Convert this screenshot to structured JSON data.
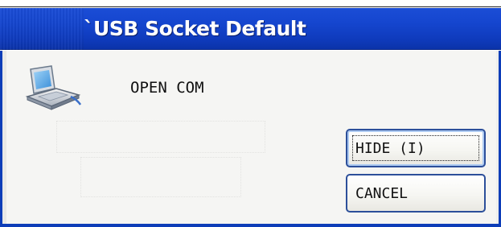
{
  "window": {
    "title": "`USB Socket Default"
  },
  "dialog": {
    "message": "OPEN COM",
    "icon": "usb-device-icon"
  },
  "buttons": {
    "hide_label": "HIDE (I)",
    "cancel_label": "CANCEL"
  },
  "colors": {
    "titlebar": "#1546cf",
    "button_border": "#2c4f9a",
    "client_background": "#f5f5f3"
  }
}
